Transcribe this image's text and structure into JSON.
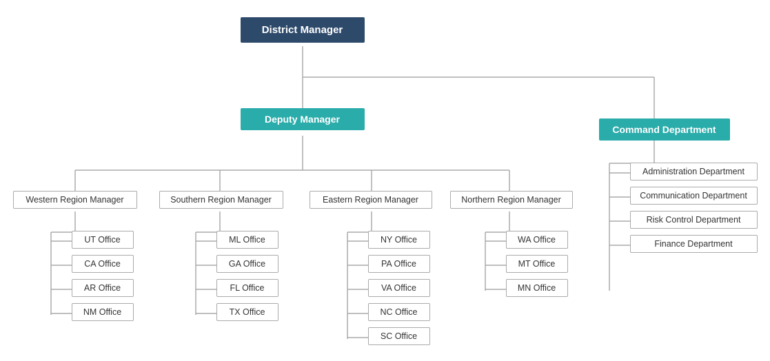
{
  "nodes": {
    "district_manager": {
      "label": "District Manager"
    },
    "deputy_manager": {
      "label": "Deputy Manager"
    },
    "command_department": {
      "label": "Command Department"
    },
    "western": {
      "label": "Western Region Manager"
    },
    "southern": {
      "label": "Southern Region Manager"
    },
    "eastern": {
      "label": "Eastern Region Manager"
    },
    "northern": {
      "label": "Northern Region Manager"
    },
    "admin": {
      "label": "Administration Department"
    },
    "comm": {
      "label": "Communication Department"
    },
    "risk": {
      "label": "Risk Control Department"
    },
    "finance": {
      "label": "Finance Department"
    },
    "ut": {
      "label": "UT Office"
    },
    "ca": {
      "label": "CA Office"
    },
    "ar": {
      "label": "AR Office"
    },
    "nm": {
      "label": "NM Office"
    },
    "ml": {
      "label": "ML Office"
    },
    "ga": {
      "label": "GA Office"
    },
    "fl": {
      "label": "FL Office"
    },
    "tx": {
      "label": "TX Office"
    },
    "ny": {
      "label": "NY Office"
    },
    "pa": {
      "label": "PA Office"
    },
    "va": {
      "label": "VA Office"
    },
    "nc": {
      "label": "NC Office"
    },
    "sc": {
      "label": "SC Office"
    },
    "wa": {
      "label": "WA Office"
    },
    "mt": {
      "label": "MT Office"
    },
    "mn": {
      "label": "MN Office"
    }
  }
}
